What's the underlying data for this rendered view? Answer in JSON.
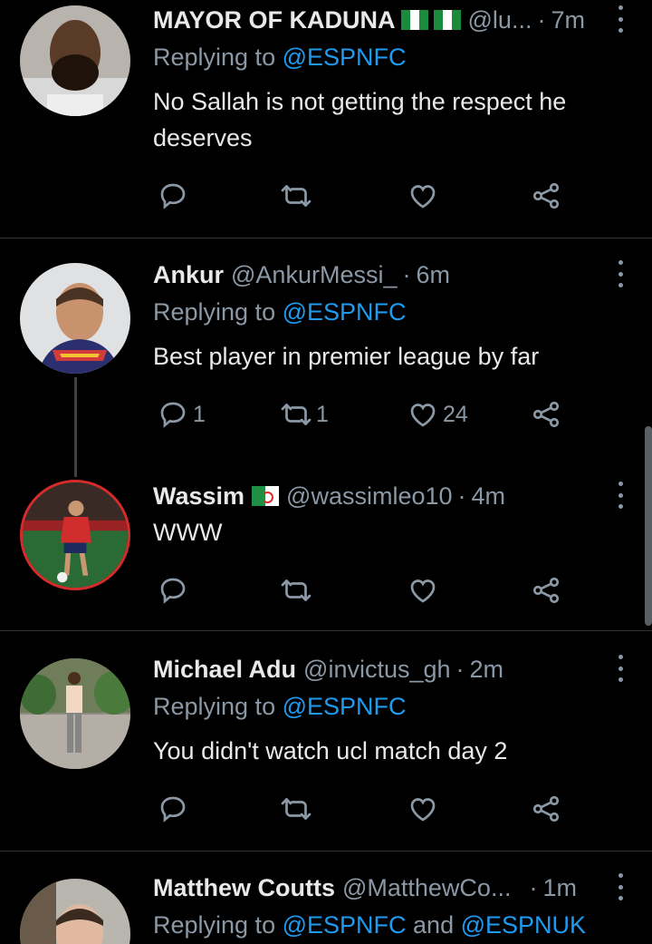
{
  "tweets": [
    {
      "name": "MAYOR OF KADUNA",
      "flags": [
        "nigeria",
        "nigeria"
      ],
      "handle": "@lu...",
      "sep": "·",
      "time": "7m",
      "reply_prefix": "Replying to ",
      "reply_to": "@ESPNFC",
      "text": "No Sallah is not getting the respect he deserves",
      "counts": {
        "reply": "",
        "retweet": "",
        "like": ""
      }
    },
    {
      "name": "Ankur",
      "flags": [],
      "handle": "@AnkurMessi_",
      "sep": "·",
      "time": "6m",
      "reply_prefix": "Replying to ",
      "reply_to": "@ESPNFC",
      "text": "Best player in premier league by far",
      "counts": {
        "reply": "1",
        "retweet": "1",
        "like": "24"
      }
    },
    {
      "name": "Wassim",
      "flags": [
        "algeria"
      ],
      "handle": "@wassimleo10",
      "sep": "·",
      "time": "4m",
      "text": "WWW",
      "counts": {
        "reply": "",
        "retweet": "",
        "like": ""
      }
    },
    {
      "name": "Michael Adu",
      "flags": [],
      "handle": "@invictus_gh",
      "sep": "·",
      "time": "2m",
      "reply_prefix": "Replying to ",
      "reply_to": "@ESPNFC",
      "text": "You didn't watch ucl match day 2",
      "counts": {
        "reply": "",
        "retweet": "",
        "like": ""
      }
    },
    {
      "name": "Matthew Coutts",
      "flags": [],
      "handle": "@MatthewCo...",
      "sep": "·",
      "time": "1m",
      "reply_prefix": "Replying to ",
      "reply_to": "@ESPNFC",
      "reply_and": " and ",
      "reply_to_2": "@ESPNUK"
    }
  ],
  "colors": {
    "background": "#000000",
    "text": "#e7e9ea",
    "secondary": "#8b98a5",
    "link": "#1d9bf0",
    "divider": "#2f3336"
  },
  "icons": [
    "reply-icon",
    "retweet-icon",
    "like-icon",
    "share-icon",
    "more-options-icon"
  ]
}
